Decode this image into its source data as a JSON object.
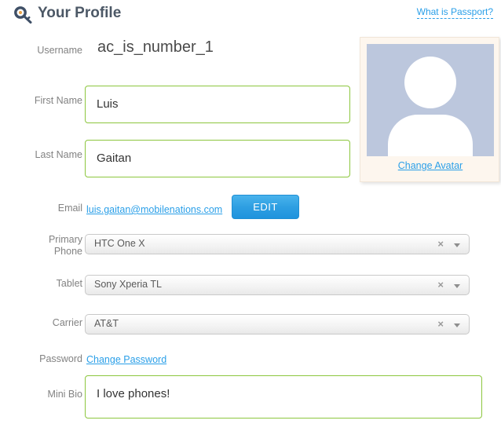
{
  "header": {
    "icon": "key-icon",
    "title": "Your Profile",
    "help_link": "What is Passport?"
  },
  "form": {
    "username": {
      "label": "Username",
      "value": "ac_is_number_1"
    },
    "first_name": {
      "label": "First Name",
      "value": "Luis"
    },
    "last_name": {
      "label": "Last Name",
      "value": "Gaitan"
    },
    "email": {
      "label": "Email",
      "value": "luis.gaitan@mobilenations.com",
      "edit_button": "EDIT"
    },
    "primary_phone": {
      "label": "Primary Phone",
      "label_line1": "Primary",
      "label_line2": "Phone",
      "value": "HTC One X",
      "clear_icon": "×",
      "arrow_icon": "▼"
    },
    "tablet": {
      "label": "Tablet",
      "value": "Sony Xperia TL",
      "clear_icon": "×",
      "arrow_icon": "▼"
    },
    "carrier": {
      "label": "Carrier",
      "value": "AT&T",
      "clear_icon": "×",
      "arrow_icon": "▼"
    },
    "password": {
      "label": "Password",
      "change_link": "Change Password"
    },
    "mini_bio": {
      "label": "Mini Bio",
      "value": "I love phones!"
    }
  },
  "avatar": {
    "change_link": "Change Avatar",
    "placeholder_icon": "user-silhouette-icon"
  },
  "colors": {
    "input_border_green": "#8cc63e",
    "link_blue": "#2a9fe8",
    "button_blue": "#2e9fe2",
    "label_gray": "#828282",
    "avatar_bg": "#bcc7dd",
    "card_bg": "#fdf6ee"
  }
}
